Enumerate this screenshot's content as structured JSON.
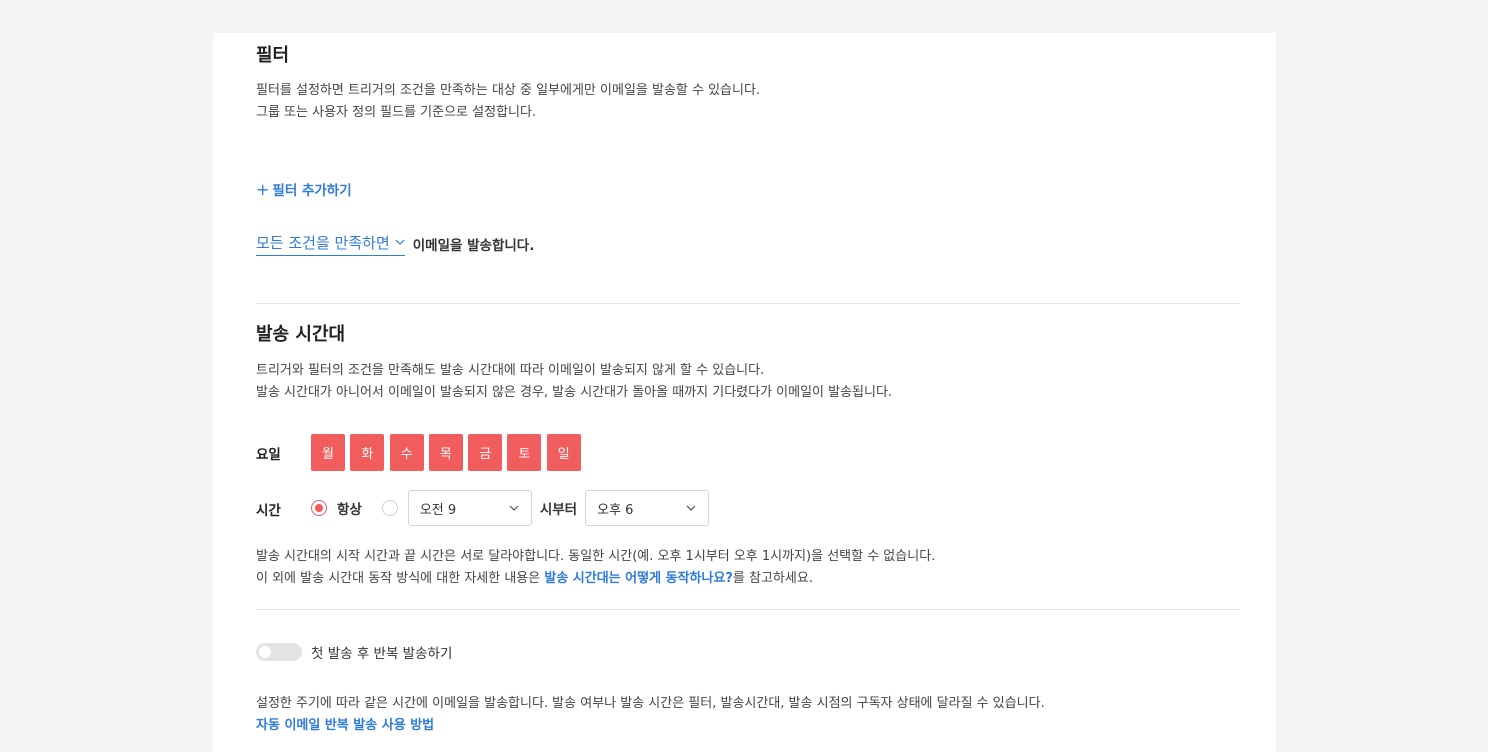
{
  "filter": {
    "title": "필터",
    "desc_line1": "필터를 설정하면 트리거의 조건을 만족하는 대상 중 일부에게만 이메일을 발송할 수 있습니다.",
    "desc_line2": "그룹 또는 사용자 정의 필드를 기준으로 설정합니다.",
    "add_button_icon": "+",
    "add_button_label": "필터 추가하기",
    "condition_select": "모든 조건을 만족하면",
    "condition_text": "이메일을 발송합니다."
  },
  "schedule": {
    "title": "발송 시간대",
    "desc_line1": "트리거와 필터의 조건을 만족해도 발송 시간대에 따라 이메일이 발송되지 않게 할 수 있습니다.",
    "desc_line2": "발송 시간대가 아니어서 이메일이 발송되지 않은 경우, 발송 시간대가 돌아올 때까지 기다렸다가 이메일이 발송됩니다.",
    "days_label": "요일",
    "days": [
      "월",
      "화",
      "수",
      "목",
      "금",
      "토",
      "일"
    ],
    "time_label": "시간",
    "always_label": "항상",
    "always_selected": true,
    "start_value": "오전 9",
    "from_label": "시부터",
    "end_value": "오후 6",
    "note_line1": "발송 시간대의 시작 시간과 끝 시간은 서로 달라야합니다. 동일한 시간(예. 오후 1시부터 오후 1시까지)을 선택할 수 없습니다.",
    "note_line2_prefix": "이 외에 발송 시간대 동작 방식에 대한 자세한 내용은 ",
    "note_line2_link": "발송 시간대는 어떻게 동작하나요?",
    "note_line2_suffix": "를 참고하세요."
  },
  "repeat": {
    "toggle_label": "첫 발송 후 반복 발송하기",
    "toggle_on": false,
    "desc": "설정한 주기에 따라 같은 시간에 이메일을 발송합니다. 발송 여부나 발송 시간은 필터, 발송시간대, 발송 시점의 구독자 상태에 달라질 수 있습니다.",
    "help_link": "자동 이메일 반복 발송 사용 방법"
  },
  "colors": {
    "accent_blue": "#2f7bd9",
    "day_active": "#f15c5c"
  },
  "icons": {
    "dropdown": "chevron-down-icon",
    "add": "plus-icon"
  }
}
